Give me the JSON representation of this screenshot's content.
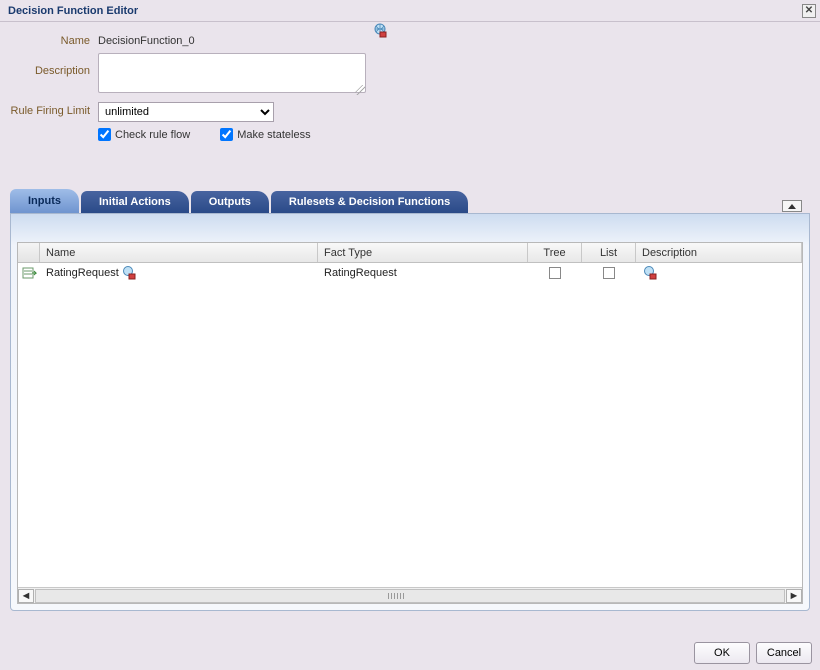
{
  "title": "Decision Function Editor",
  "form": {
    "name_label": "Name",
    "name_value": "DecisionFunction_0",
    "description_label": "Description",
    "description_value": "",
    "rule_limit_label": "Rule Firing Limit",
    "rule_limit_value": "unlimited",
    "check_rule_flow_label": "Check rule flow",
    "check_rule_flow_checked": true,
    "make_stateless_label": "Make stateless",
    "make_stateless_checked": true
  },
  "tabs": {
    "inputs": "Inputs",
    "initial_actions": "Initial Actions",
    "outputs": "Outputs",
    "rulesets": "Rulesets & Decision Functions",
    "active": "inputs"
  },
  "grid": {
    "columns": {
      "name": "Name",
      "fact_type": "Fact Type",
      "tree": "Tree",
      "list": "List",
      "description": "Description"
    },
    "rows": [
      {
        "name": "RatingRequest",
        "fact_type": "RatingRequest",
        "tree": false,
        "list": false,
        "description": ""
      }
    ]
  },
  "buttons": {
    "ok": "OK",
    "cancel": "Cancel"
  }
}
